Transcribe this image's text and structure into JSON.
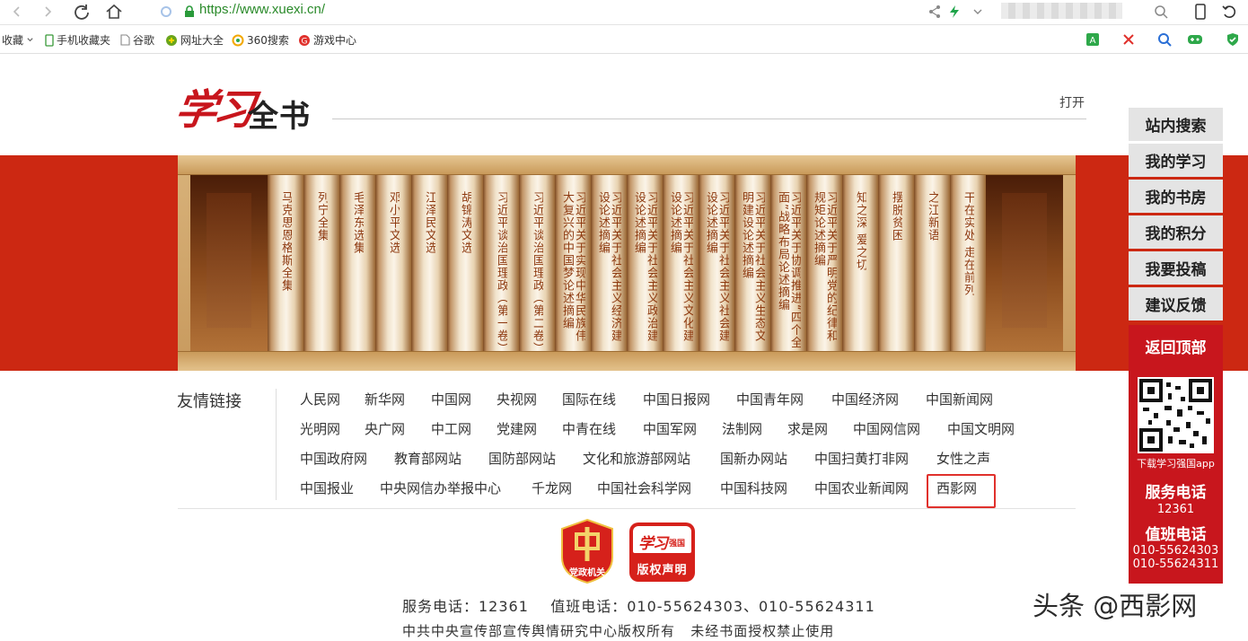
{
  "browser": {
    "url": "https://www.xuexi.cn/",
    "bookmarks": [
      "收藏",
      "手机收藏夹",
      "谷歌",
      "网址大全",
      "360搜索",
      "游戏中心"
    ]
  },
  "header": {
    "logo_red": "学习",
    "logo_black": "全书",
    "open_label": "打开"
  },
  "books": [
    "马克思恩格斯全集",
    "列宁全集",
    "毛泽东选集",
    "邓小平文选",
    "江泽民文选",
    "胡锦涛文选",
    "习近平谈治国理政（第一卷）",
    "习近平谈治国理政（第二卷）",
    "习近平关于实现中华民族伟大复兴的中国梦论述摘编",
    "习近平关于社会主义经济建设论述摘编",
    "习近平关于社会主义政治建设论述摘编",
    "习近平关于社会主义文化建设论述摘编",
    "习近平关于社会主义社会建设论述摘编",
    "习近平关于社会主义生态文明建设论述摘编",
    "习近平关于协调推进“四个全面”战略布局论述摘编",
    "习近平关于严明党的纪律和规矩论述摘编",
    "知之深 爱之切",
    "摆脱贫困",
    "之江新语",
    "干在实处 走在前列"
  ],
  "links": {
    "title": "友情链接",
    "rows": [
      [
        "人民网",
        "新华网",
        "中国网",
        "央视网",
        "国际在线",
        "中国日报网",
        "中国青年网",
        "中国经济网",
        "中国新闻网"
      ],
      [
        "光明网",
        "央广网",
        "中工网",
        "党建网",
        "中青在线",
        "中国军网",
        "法制网",
        "求是网",
        "中国网信网",
        "中国文明网"
      ],
      [
        "中国政府网",
        "教育部网站",
        "国防部网站",
        "文化和旅游部网站",
        "国新办网站",
        "中国扫黄打非网",
        "女性之声"
      ],
      [
        "中国报业",
        "中央网信办举报中心",
        "千龙网",
        "中国社会科学网",
        "中国科技网",
        "中国农业新闻网",
        "西影网"
      ]
    ]
  },
  "badges": {
    "badge1_label": "党政机关",
    "badge2_logo": "学习",
    "badge2_sub": "强国",
    "badge2_label": "版权声明"
  },
  "footer": {
    "phones": "服务电话：12361    值班电话：010-55624303、010-55624311",
    "copyright": "中共中央宣传部宣传舆情研究中心版权所有   未经书面授权禁止使用"
  },
  "sidepanel": {
    "items": [
      "站内搜索",
      "我的学习",
      "我的书房",
      "我的积分",
      "我要投稿",
      "建议反馈"
    ],
    "back_top": "返回顶部",
    "qr_caption": "下载学习强国app",
    "service_title": "服务电话",
    "service_number": "12361",
    "duty_title": "值班电话",
    "duty_number_1": "010-55624303",
    "duty_number_2": "010-55624311"
  },
  "watermark": "头条 @西影网",
  "colors": {
    "brand_red": "#c8161d",
    "banner_red": "#cc2812",
    "url_green": "#2a8a2a"
  }
}
